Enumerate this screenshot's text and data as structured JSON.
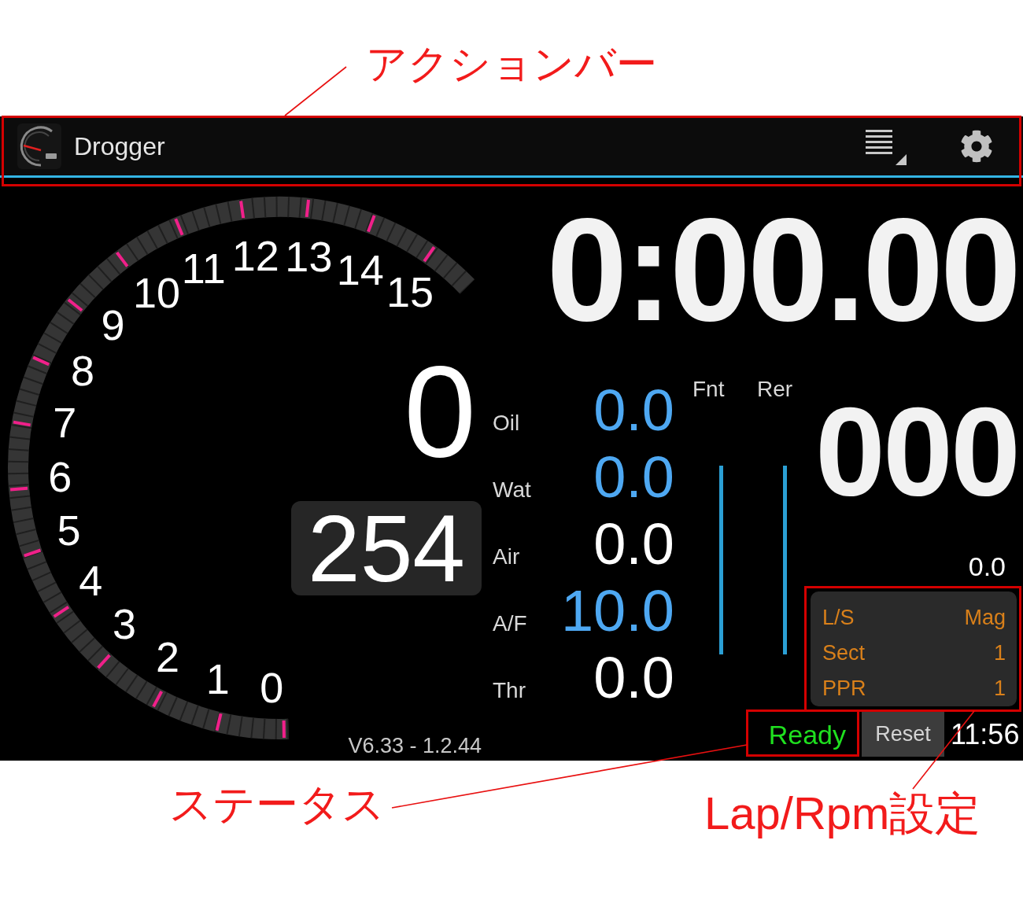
{
  "annotations": [
    {
      "text": "アクションバー"
    },
    {
      "text": "ステータス"
    },
    {
      "text": "Lap/Rpm設定"
    }
  ],
  "action_bar": {
    "title": "Drogger"
  },
  "tachometer": {
    "scale_labels": [
      "9",
      "10",
      "11",
      "12",
      "13",
      "14",
      "15",
      "8",
      "7",
      "6",
      "5",
      "4",
      "3",
      "2",
      "1",
      "0"
    ]
  },
  "center_reading": "0",
  "boxed_reading": "254",
  "timer": "0:00.00",
  "sensors": [
    {
      "label": "Oil",
      "value": "0.0",
      "color": "#4ea8f2"
    },
    {
      "label": "Wat",
      "value": "0.0",
      "color": "#4ea8f2"
    },
    {
      "label": "Air",
      "value": "0.0",
      "color": "#ffffff"
    },
    {
      "label": "A/F",
      "value": "10.0",
      "color": "#4ea8f2"
    },
    {
      "label": "Thr",
      "value": "0.0",
      "color": "#ffffff"
    }
  ],
  "bar_columns": [
    {
      "label": "Fnt"
    },
    {
      "label": "Rer"
    }
  ],
  "right_reading": "000",
  "right_subreading": "0.0",
  "lap_settings": [
    {
      "label": "L/S",
      "value": "Mag"
    },
    {
      "label": "Sect",
      "value": "1"
    },
    {
      "label": "PPR",
      "value": "1"
    }
  ],
  "status": {
    "text": "Ready",
    "kind": "ready"
  },
  "reset_button": {
    "label": "Reset"
  },
  "clock": "11:56",
  "version": "V6.33 - 1.2.44"
}
